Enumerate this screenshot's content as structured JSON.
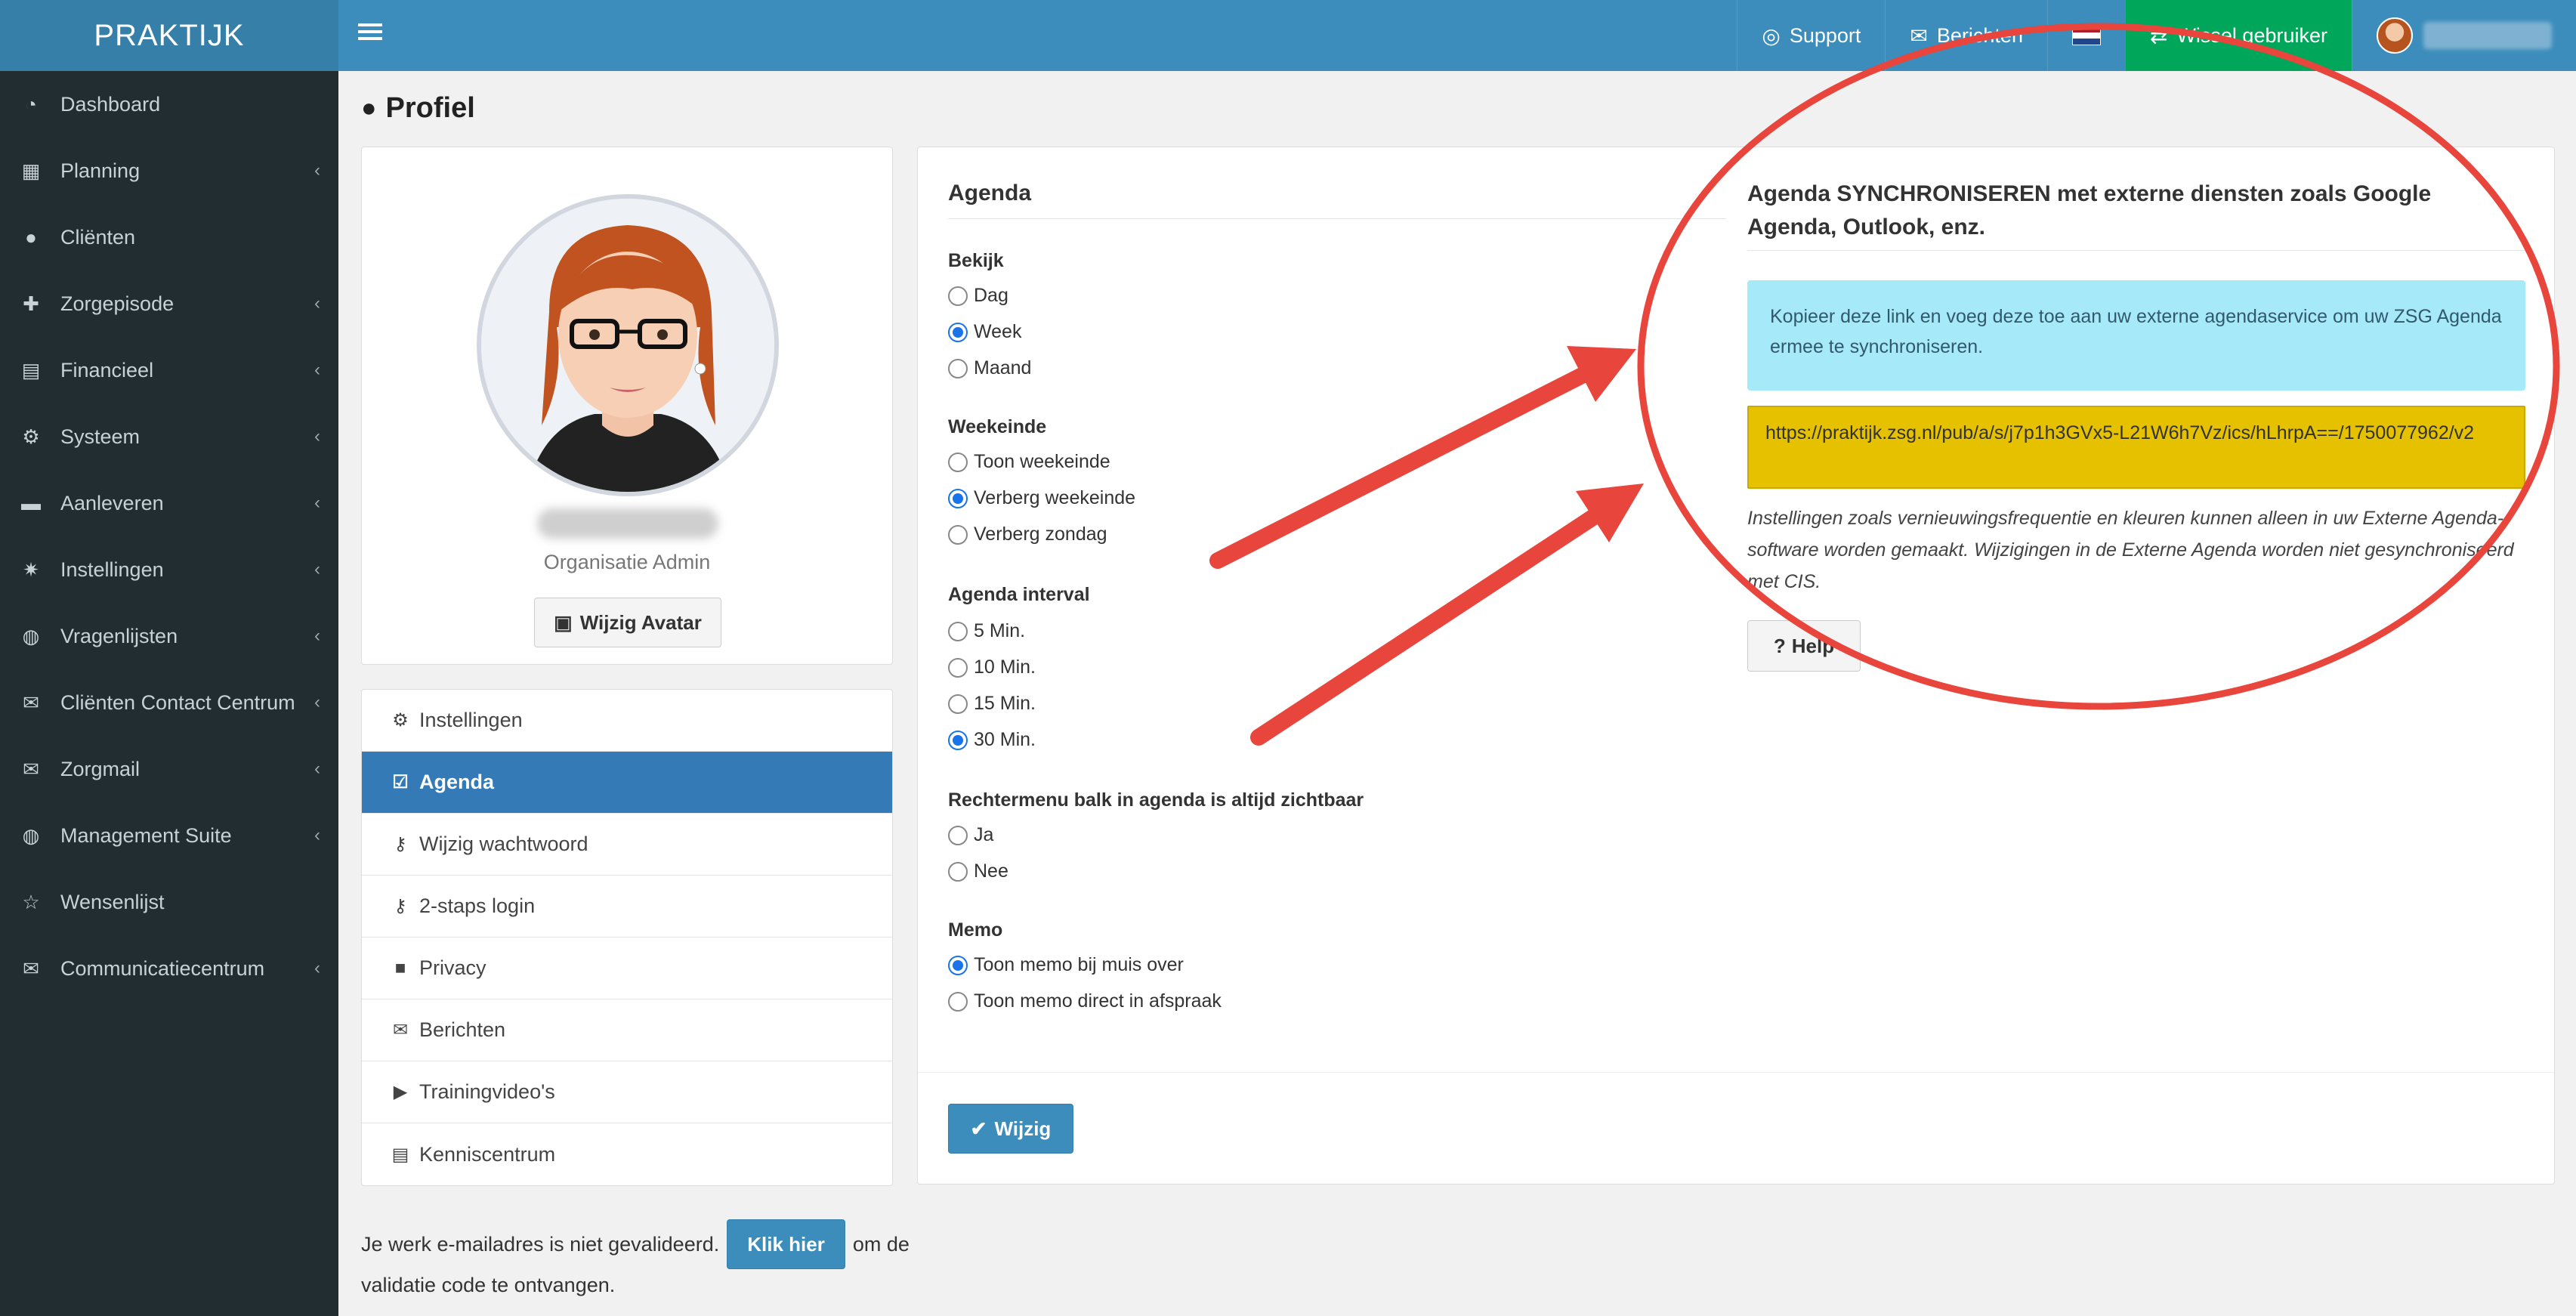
{
  "brand": "PRAKTIJK",
  "sidebar": {
    "items": [
      {
        "label": "Dashboard",
        "icon": "dashboard-icon",
        "submenu": false
      },
      {
        "label": "Planning",
        "icon": "calendar-icon",
        "submenu": true
      },
      {
        "label": "Cliënten",
        "icon": "user-icon",
        "submenu": false
      },
      {
        "label": "Zorgepisode",
        "icon": "medkit-icon",
        "submenu": true
      },
      {
        "label": "Financieel",
        "icon": "book-icon",
        "submenu": true
      },
      {
        "label": "Systeem",
        "icon": "cogs-icon",
        "submenu": true
      },
      {
        "label": "Aanleveren",
        "icon": "truck-icon",
        "submenu": true
      },
      {
        "label": "Instellingen",
        "icon": "gear-icon",
        "submenu": true
      },
      {
        "label": "Vragenlijsten",
        "icon": "globe-icon",
        "submenu": true
      },
      {
        "label": "Cliënten Contact Centrum",
        "icon": "envelope-icon",
        "submenu": true
      },
      {
        "label": "Zorgmail",
        "icon": "envelope-icon",
        "submenu": true
      },
      {
        "label": "Management Suite",
        "icon": "globe-icon",
        "submenu": true
      },
      {
        "label": "Wensenlijst",
        "icon": "star-icon",
        "submenu": false
      },
      {
        "label": "Communicatiecentrum",
        "icon": "envelope-icon",
        "submenu": true
      }
    ]
  },
  "topbar": {
    "support": "Support",
    "berichten": "Berichten",
    "wissel": "Wissel gebruiker",
    "language_flag": "nl-flag-icon"
  },
  "page": {
    "title": "Profiel"
  },
  "profile": {
    "role": "Organisatie Admin",
    "avatar_button": "Wijzig Avatar"
  },
  "submenu": {
    "items": [
      {
        "label": "Instellingen",
        "icon": "cogs-icon",
        "active": false
      },
      {
        "label": "Agenda",
        "icon": "calendar-check-icon",
        "active": true
      },
      {
        "label": "Wijzig wachtwoord",
        "icon": "key-icon",
        "active": false
      },
      {
        "label": "2-staps login",
        "icon": "key-icon",
        "active": false
      },
      {
        "label": "Privacy",
        "icon": "lock-icon",
        "active": false
      },
      {
        "label": "Berichten",
        "icon": "envelope-icon",
        "active": false
      },
      {
        "label": "Trainingvideo's",
        "icon": "play-icon",
        "active": false
      },
      {
        "label": "Kenniscentrum",
        "icon": "book-icon",
        "active": false
      }
    ]
  },
  "validation": {
    "text_before": "Je werk e-mailadres is niet gevalideerd.",
    "button": "Klik hier",
    "text_after": "om de",
    "text_line2": "validatie code te ontvangen."
  },
  "agenda": {
    "section_title": "Agenda",
    "bekijk": {
      "label": "Bekijk",
      "options": [
        "Dag",
        "Week",
        "Maand"
      ],
      "selected": "Week"
    },
    "weekeinde": {
      "label": "Weekeinde",
      "options": [
        "Toon weekeinde",
        "Verberg weekeinde",
        "Verberg zondag"
      ],
      "selected": "Verberg weekeinde"
    },
    "interval": {
      "label": "Agenda interval",
      "options": [
        "5 Min.",
        "10 Min.",
        "15 Min.",
        "30 Min."
      ],
      "selected": "30 Min."
    },
    "rechtermenu": {
      "label": "Rechtermenu balk in agenda is altijd zichtbaar",
      "options": [
        "Ja",
        "Nee"
      ],
      "selected": null
    },
    "memo": {
      "label": "Memo",
      "options": [
        "Toon memo bij muis over",
        "Toon memo direct in afspraak"
      ],
      "selected": "Toon memo bij muis over"
    },
    "submit": "Wijzig"
  },
  "sync": {
    "title": "Agenda SYNCHRONISEREN met externe diensten zoals Google Agenda, Outlook, enz.",
    "info": "Kopieer deze link en voeg deze toe aan uw externe agendaservice om uw ZSG Agenda ermee te synchroniseren.",
    "url": "https://praktijk.zsg.nl/pub/a/s/j7p1h3GVx5-L21W6h7Vz/ics/hLhrpA==/1750077962/v2",
    "note": "Instellingen zoals vernieuwingsfrequentie en kleuren kunnen alleen in uw Externe Agenda-software worden gemaakt. Wijzigingen in de Externe Agenda worden niet gesynchroniseerd met CIS.",
    "help": "Help"
  },
  "colors": {
    "sidebar_bg": "#222d32",
    "topbar_bg": "#3c8dbc",
    "active_bg": "#337ab7",
    "info_bg": "#a6eaf9",
    "url_highlight": "#e5c100",
    "annotation": "#e8453c",
    "wissel_bg": "#00a65a"
  }
}
